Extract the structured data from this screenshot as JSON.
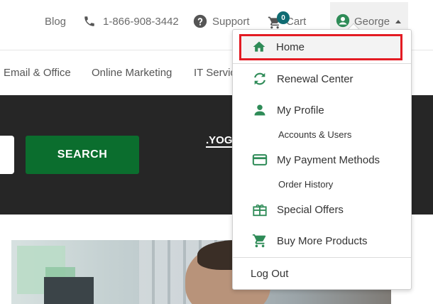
{
  "topbar": {
    "blog": "Blog",
    "phone": "1-866-908-3442",
    "support": "Support",
    "cart_label": "Cart",
    "cart_count": "0",
    "account_name": "George"
  },
  "nav": {
    "items": [
      "Email & Office",
      "Online Marketing",
      "IT Servic"
    ]
  },
  "hero": {
    "search_button": "SEARCH",
    "tld_text": ".YOG"
  },
  "dropdown": {
    "items": [
      {
        "label": "Home",
        "icon": "home-icon"
      },
      {
        "label": "Renewal Center",
        "icon": "renew-icon"
      },
      {
        "label": "My Profile",
        "icon": "person-icon"
      },
      {
        "label": "Accounts & Users"
      },
      {
        "label": "My Payment Methods",
        "icon": "credit-card-icon"
      },
      {
        "label": "Order History"
      },
      {
        "label": "Special Offers",
        "icon": "gift-icon"
      },
      {
        "label": "Buy More Products",
        "icon": "cart-icon"
      },
      {
        "label": "Log Out"
      }
    ]
  },
  "colors": {
    "accent_green": "#2e8b57",
    "search_green": "#0b6e2e",
    "badge_teal": "#0f6b72",
    "highlight_red": "#e31b23",
    "hero_dark": "#262626"
  }
}
